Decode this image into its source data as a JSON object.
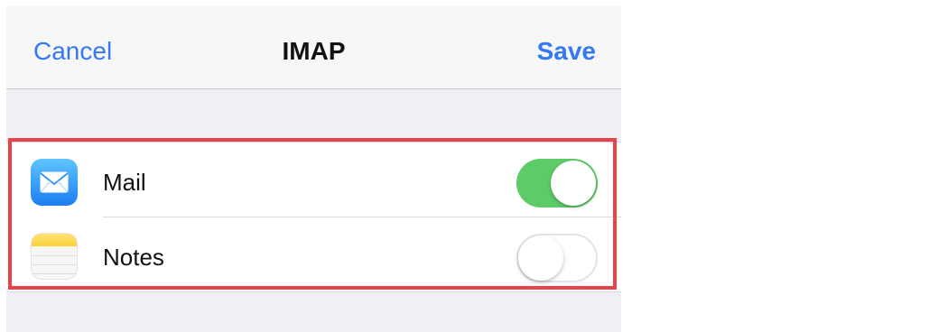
{
  "navbar": {
    "cancel_label": "Cancel",
    "title": "IMAP",
    "save_label": "Save"
  },
  "accounts": [
    {
      "label": "Mail",
      "icon": "mail-app-icon",
      "enabled": true
    },
    {
      "label": "Notes",
      "icon": "notes-app-icon",
      "enabled": false
    }
  ],
  "colors": {
    "accent": "#3478f6",
    "toggle_on": "#5dcb67",
    "highlight": "#e8434a"
  }
}
